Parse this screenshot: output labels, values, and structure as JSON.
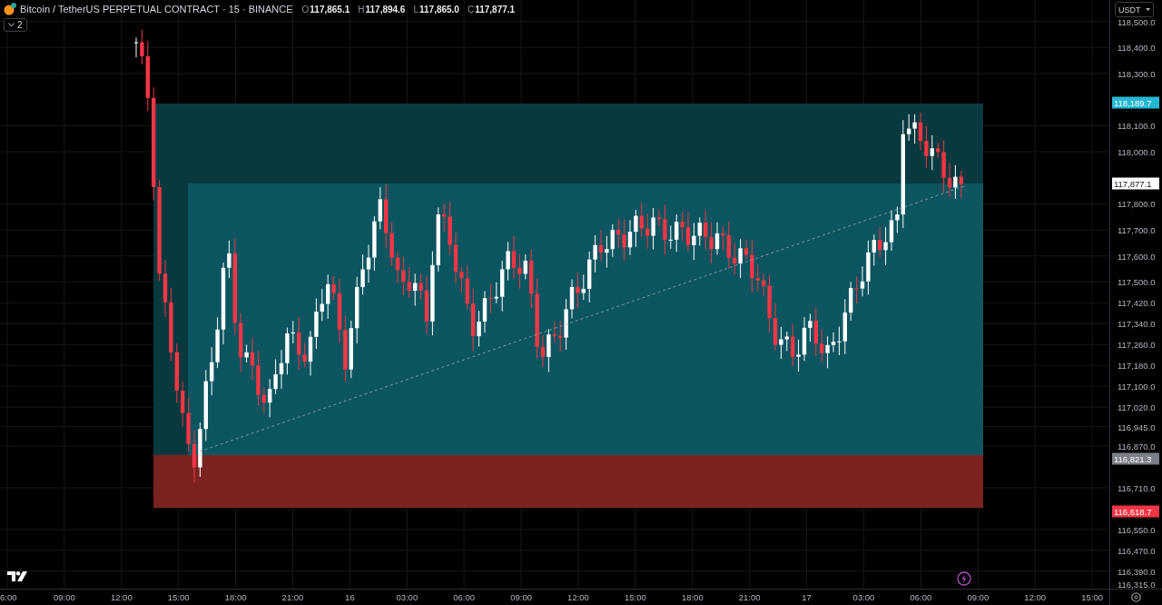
{
  "header": {
    "symbol": "Bitcoin / TetherUS PERPETUAL CONTRACT · 15 · BINANCE",
    "ohlc": [
      {
        "label": "O",
        "value": "117,865.1"
      },
      {
        "label": "H",
        "value": "117,894.6"
      },
      {
        "label": "L",
        "value": "117,865.0"
      },
      {
        "label": "C",
        "value": "117,877.1"
      }
    ],
    "indicators_toggle": {
      "count": "2"
    }
  },
  "currency_menu": {
    "label": "USDT"
  },
  "price_axis": {
    "ticks": [
      "118,500.0",
      "118,400.0",
      "118,300.0",
      "118,100.0",
      "118,000.0",
      "117,800.0",
      "117,700.0",
      "117,600.0",
      "117,500.0",
      "117,420.0",
      "117,340.0",
      "117,260.0",
      "117,180.0",
      "117,100.0",
      "117,020.0",
      "116,945.0",
      "116,870.0",
      "116,710.0",
      "116,550.0",
      "116,470.0",
      "116,390.0",
      "116,315.0"
    ],
    "tags": [
      {
        "text": "118,189.7",
        "color": "#22b8d4"
      },
      {
        "text": "117,877.1",
        "color": "#ffffff"
      },
      {
        "text": "116,821.3",
        "color": "#7b7e88"
      },
      {
        "text": "116,618.7",
        "color": "#f23645"
      }
    ]
  },
  "time_axis": {
    "ticks": [
      "6:00",
      "09:00",
      "12:00",
      "15:00",
      "18:00",
      "21:00",
      "16",
      "03:00",
      "06:00",
      "09:00",
      "12:00",
      "15:00",
      "18:00",
      "21:00",
      "17",
      "03:00",
      "06:00",
      "09:00",
      "12:00",
      "15:00"
    ]
  }
}
